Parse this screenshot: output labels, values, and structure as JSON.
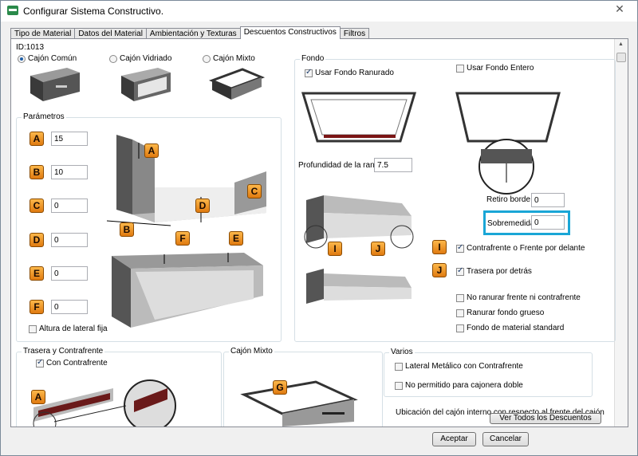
{
  "window": {
    "title": "Configurar Sistema Constructivo.",
    "close_label": "✕"
  },
  "tabs": [
    "Tipo de Material",
    "Datos del Material",
    "Ambientación y Texturas",
    "Descuentos Constructivos",
    "Filtros"
  ],
  "id_label": "ID:1013",
  "drawer_types": [
    {
      "label": "Cajón Común",
      "selected": true
    },
    {
      "label": "Cajón Vidriado",
      "selected": false
    },
    {
      "label": "Cajón Mixto",
      "selected": false
    }
  ],
  "parametros": {
    "title": "Parámetros",
    "rows": [
      {
        "letter": "A",
        "value": "15"
      },
      {
        "letter": "B",
        "value": "10"
      },
      {
        "letter": "C",
        "value": "0"
      },
      {
        "letter": "D",
        "value": "0"
      },
      {
        "letter": "E",
        "value": "0"
      },
      {
        "letter": "F",
        "value": "0"
      }
    ],
    "fixed_side_label": "Altura de lateral fija",
    "diagram_letters": [
      "A",
      "B",
      "C",
      "D",
      "E",
      "F"
    ]
  },
  "fondo": {
    "title": "Fondo",
    "grooved_label": "Usar Fondo Ranurado",
    "whole_label": "Usar Fondo Entero",
    "groove_depth_label": "Profundidad de la ranura",
    "groove_depth_value": "7.5",
    "retiro_label": "Retiro borde",
    "retiro_value": "0",
    "sobremedida_label": "Sobremedida",
    "sobremedida_value": "0",
    "front_label": "Contrafrente o Frente por delante",
    "back_label": "Trasera por detrás",
    "badge_i": "I",
    "badge_j": "J",
    "no_groove_label": "No ranurar frente ni contrafrente",
    "thick_label": "Ranurar fondo grueso",
    "standard_label": "Fondo de material standard"
  },
  "trasera": {
    "title": "Trasera y Contrafrente",
    "con_label": "Con Contrafrente",
    "badge": "A"
  },
  "mixto": {
    "title": "Cajón Mixto",
    "badge": "G"
  },
  "varios": {
    "title": "Varios",
    "metal_label": "Lateral Metálico con Contrafrente",
    "double_label": "No permitido para cajonera doble"
  },
  "ubicacion_label": "Ubicación del cajón interno con respecto al frente del cajón",
  "ver_todos_label": "Ver Todos los Descuentos",
  "buttons": {
    "accept": "Aceptar",
    "cancel": "Cancelar"
  }
}
